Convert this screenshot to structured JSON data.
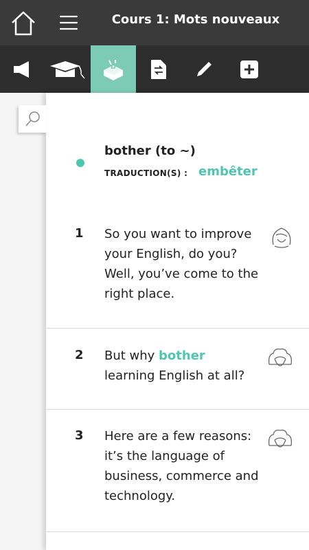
{
  "header": {
    "title": "Cours 1: Mots nouveaux",
    "home_icon": "home-icon",
    "menu_icon": "hamburger-menu-icon"
  },
  "toolbar": {
    "active_tab": "vocabulary",
    "accent_color": "#7dcab5",
    "tabs": [
      {
        "name": "audio",
        "icon": "speaker-icon"
      },
      {
        "name": "lesson",
        "icon": "graduation-cap-icon"
      },
      {
        "name": "vocabulary",
        "icon": "vocabulary-box-icon"
      },
      {
        "name": "translation",
        "icon": "document-arrows-icon"
      },
      {
        "name": "notes",
        "icon": "pencil-icon"
      },
      {
        "name": "add",
        "icon": "plus-square-icon"
      }
    ]
  },
  "search": {
    "icon": "search-icon"
  },
  "entry": {
    "word": "bother (to ~)",
    "translation_label": "TRADUCTION(S) :",
    "translation": "embêter"
  },
  "sentences": [
    {
      "num": "1",
      "before": "So you want to improve your English, do you? Well, you’ve come to the right place.",
      "highlight": "",
      "after": "",
      "icon": "female-speaker-icon"
    },
    {
      "num": "2",
      "before": "But why ",
      "highlight": "bother",
      "after": " learning English at all?",
      "icon": "male-speaker-icon"
    },
    {
      "num": "3",
      "before": "Here are a few reasons: it’s the language of business, commerce and technology.",
      "highlight": "",
      "after": "",
      "icon": "male-speaker-icon"
    }
  ]
}
